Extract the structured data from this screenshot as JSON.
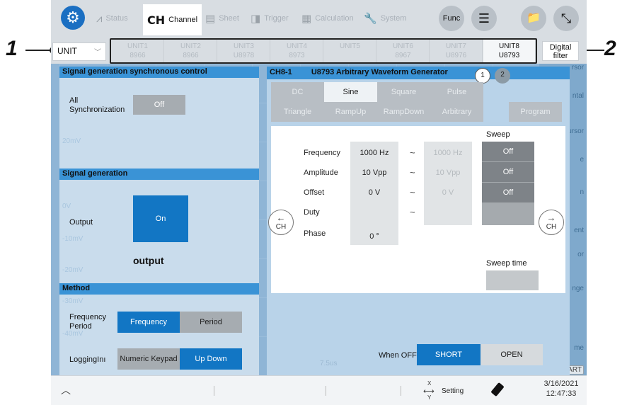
{
  "callouts": {
    "left": "1",
    "right": "2"
  },
  "toolbar": {
    "gear": "⚙",
    "tabs": [
      {
        "label": "Status",
        "icon": "waveform-icon",
        "glyph": "⩘"
      },
      {
        "label": "Channel",
        "icon": "ch-icon",
        "glyph": "CH"
      },
      {
        "label": "Sheet",
        "icon": "sheet-icon",
        "glyph": "▤"
      },
      {
        "label": "Trigger",
        "icon": "trigger-icon",
        "glyph": "◨"
      },
      {
        "label": "Calculation",
        "icon": "calculator-icon",
        "glyph": "▦"
      },
      {
        "label": "System",
        "icon": "wrench-icon",
        "glyph": "🔧"
      }
    ],
    "func_label": "Func",
    "menu_glyph": "☰",
    "folder_glyph": "📁",
    "expand_glyph": "⤡"
  },
  "unit_strip": {
    "selected": "UNIT",
    "tabs": [
      {
        "line1": "UNIT1",
        "line2": "8966"
      },
      {
        "line1": "UNIT2",
        "line2": "8966"
      },
      {
        "line1": "UNIT3",
        "line2": "U8978"
      },
      {
        "line1": "UNIT4",
        "line2": "8973"
      },
      {
        "line1": "UNIT5",
        "line2": ""
      },
      {
        "line1": "UNIT6",
        "line2": "8967"
      },
      {
        "line1": "UNIT7",
        "line2": "U8976"
      },
      {
        "line1": "UNIT8",
        "line2": "U8793"
      }
    ],
    "digital_line1": "Digital",
    "digital_line2": "filter"
  },
  "background": {
    "rail_items": [
      "rsor",
      "ntal",
      "ursor",
      "e",
      "n",
      "ent",
      "or",
      "nge",
      "me",
      "TART"
    ],
    "faint_labels": [
      "20mV",
      "0V",
      "-10mV",
      "-20mV",
      "-30mV",
      "-40mV",
      "7.5us"
    ]
  },
  "left_panel": {
    "sync_header": "Signal generation synchronous control",
    "all_sync_label": "All Synchronization",
    "all_sync_value": "Off",
    "gen_header": "Signal generation",
    "output_label": "Output",
    "output_value": "On",
    "output_caption": "output",
    "method_header": "Method",
    "freq_period_label": "Frequency Period",
    "freq_option": "Frequency",
    "period_option": "Period",
    "logging_label": "LoggingInı",
    "keypad_option": "Numeric Keypad",
    "updown_option": "Up Down"
  },
  "right_panel": {
    "title_ch": "CH8-1",
    "title": "U8793 Arbitrary Waveform Generator",
    "page1": "1",
    "page2": "2",
    "wave_row1": [
      "DC",
      "Sine",
      "Square",
      "Pulse"
    ],
    "wave_row2": [
      "Triangle",
      "RampUp",
      "RampDown",
      "Arbitrary"
    ],
    "program_label": "Program",
    "sweep_header": "Sweep",
    "rows": [
      {
        "label": "Frequency",
        "value": "1000 Hz",
        "end": "1000 Hz",
        "sweep": "Off"
      },
      {
        "label": "Amplitude",
        "value": "10 Vpp",
        "end": "10 Vpp",
        "sweep": "Off"
      },
      {
        "label": "Offset",
        "value": "0 V",
        "end": "0 V",
        "sweep": "Off"
      },
      {
        "label": "Duty",
        "value": "",
        "end": "",
        "sweep": ""
      },
      {
        "label": "Phase",
        "value": "0 °",
        "end": "",
        "sweep": ""
      }
    ],
    "tilde": "~",
    "prev_label": "CH",
    "next_label": "CH",
    "sweep_time_label": "Sweep time",
    "when_off_label": "When OFF",
    "short_option": "SHORT",
    "open_option": "OPEN"
  },
  "statusbar": {
    "caret": "︿",
    "setting_label": "Setting",
    "x_label": "X",
    "y_label": "Y",
    "date": "3/16/2021",
    "time": "12:47:33"
  }
}
